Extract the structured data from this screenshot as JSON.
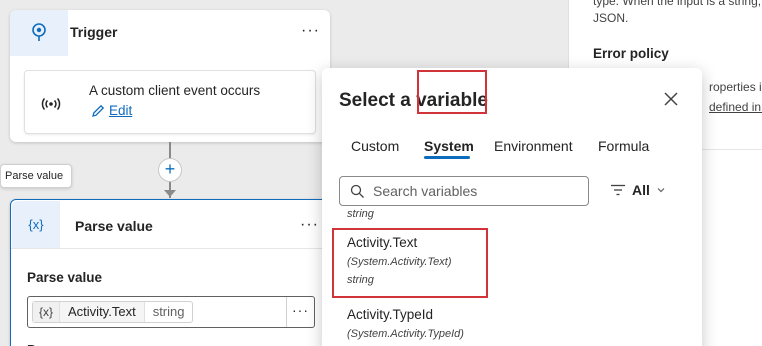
{
  "canvas": {
    "trigger": {
      "title": "Trigger",
      "more": "···",
      "event_text": "A custom client event occurs",
      "edit_label": "Edit"
    },
    "add_button": "+",
    "tooltip": "Parse value",
    "parse_node": {
      "title": "Parse value",
      "more": "···",
      "label": "Parse value",
      "chip_icon": "{x}",
      "chip_name": "Activity.Text",
      "chip_type": "string",
      "field_more": "···",
      "cut_label": "P"
    }
  },
  "right_panel": {
    "line1": "type. When the input is a string,",
    "line2": "JSON.",
    "heading": "Error policy",
    "line3": "roperties in",
    "line4": "defined in t"
  },
  "popup": {
    "title": "Select a variable",
    "tabs": [
      {
        "label": "Custom"
      },
      {
        "label": "System"
      },
      {
        "label": "Environment"
      },
      {
        "label": "Formula"
      }
    ],
    "active_tab": "System",
    "search_placeholder": "Search variables",
    "filter_label": "All",
    "list": {
      "partial_type": "string",
      "items": [
        {
          "name": "Activity.Text",
          "path": "(System.Activity.Text)",
          "type": "string"
        },
        {
          "name": "Activity.TypeId",
          "path": "(System.Activity.TypeId)"
        }
      ]
    }
  },
  "colors": {
    "accent": "#0f6cbd",
    "highlight": "#d13438"
  },
  "icons": {
    "trigger": "lightbulb-icon",
    "event": "broadcast-icon",
    "edit": "pencil-icon",
    "variable": "variable-icon",
    "close": "close-icon",
    "search": "search-icon",
    "filter": "filter-icon",
    "chevron": "chevron-down-icon"
  }
}
